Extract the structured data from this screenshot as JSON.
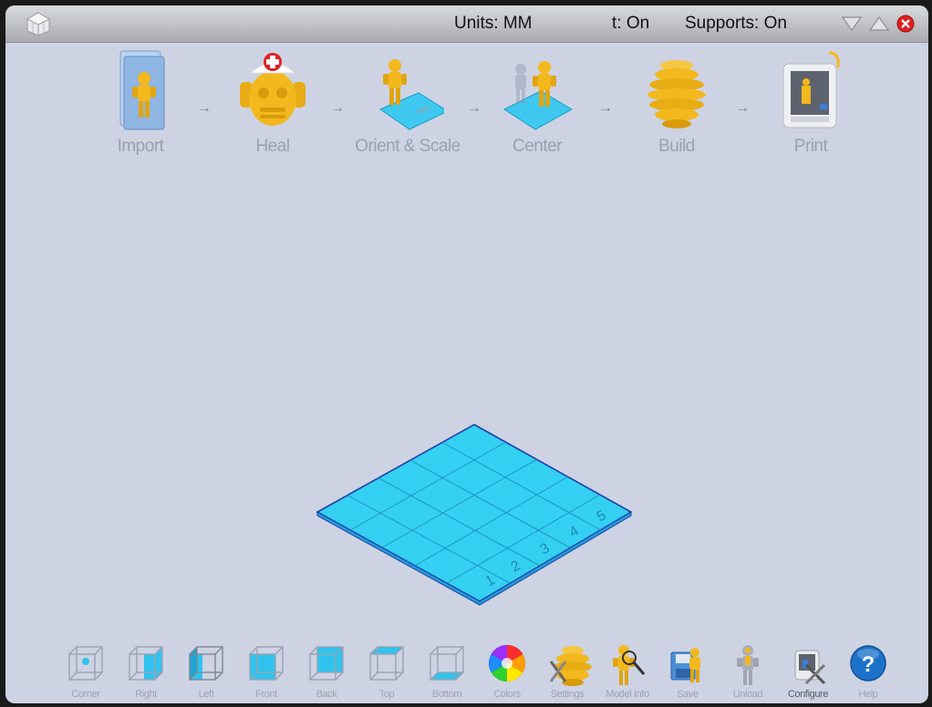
{
  "titlebar": {
    "units": "Units: MM",
    "toggle": "t: On",
    "supports": "Supports: On"
  },
  "steps": [
    {
      "label": "Import",
      "icon": "import-icon"
    },
    {
      "label": "Heal",
      "icon": "heal-icon"
    },
    {
      "label": "Orient & Scale",
      "icon": "orient-scale-icon"
    },
    {
      "label": "Center",
      "icon": "center-icon"
    },
    {
      "label": "Build",
      "icon": "build-icon"
    },
    {
      "label": "Print",
      "icon": "printer-icon"
    }
  ],
  "step_arrow": "→",
  "plate": {
    "grid_numbers": [
      "1",
      "2",
      "3",
      "4",
      "5"
    ],
    "color": "#34d0f2"
  },
  "toolbar": [
    {
      "label": "Corner"
    },
    {
      "label": "Right"
    },
    {
      "label": "Left"
    },
    {
      "label": "Front"
    },
    {
      "label": "Back"
    },
    {
      "label": "Top"
    },
    {
      "label": "Bottom"
    },
    {
      "label": "Colors"
    },
    {
      "label": "Settings"
    },
    {
      "label": "Model Info"
    },
    {
      "label": "Save"
    },
    {
      "label": "Unload"
    },
    {
      "label": "Configure"
    },
    {
      "label": "Help"
    }
  ],
  "colors": {
    "background": "#cdd3e3",
    "accent_gold": "#f2b81d",
    "plate_cyan": "#34d0f2",
    "help_blue": "#1c72c9"
  }
}
